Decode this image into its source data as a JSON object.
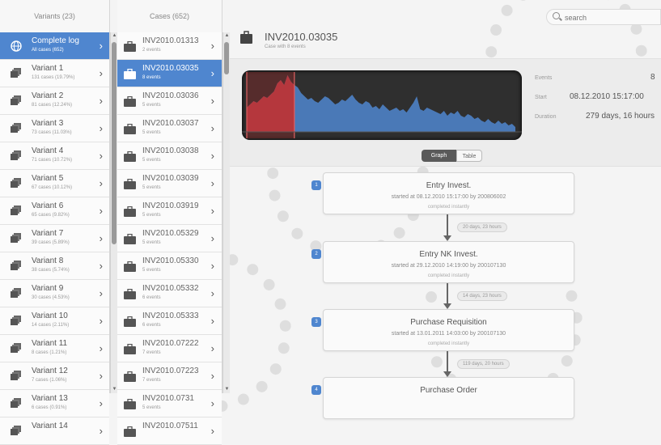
{
  "variants": {
    "header": "Variants (23)",
    "items": [
      {
        "title": "Complete log",
        "sub": "All cases (652)",
        "selected": true
      },
      {
        "title": "Variant 1",
        "sub": "131 cases (19.79%)"
      },
      {
        "title": "Variant 2",
        "sub": "81 cases (12.24%)"
      },
      {
        "title": "Variant 3",
        "sub": "73 cases (11.03%)"
      },
      {
        "title": "Variant 4",
        "sub": "71 cases (10.72%)"
      },
      {
        "title": "Variant 5",
        "sub": "67 cases (10.12%)"
      },
      {
        "title": "Variant 6",
        "sub": "65 cases (9.82%)"
      },
      {
        "title": "Variant 7",
        "sub": "39 cases (5.89%)"
      },
      {
        "title": "Variant 8",
        "sub": "38 cases (5.74%)"
      },
      {
        "title": "Variant 9",
        "sub": "30 cases (4.53%)"
      },
      {
        "title": "Variant 10",
        "sub": "14 cases (2.11%)"
      },
      {
        "title": "Variant 11",
        "sub": "8 cases (1.21%)"
      },
      {
        "title": "Variant 12",
        "sub": "7 cases (1.06%)"
      },
      {
        "title": "Variant 13",
        "sub": "6 cases (0.91%)"
      },
      {
        "title": "Variant 14",
        "sub": ""
      }
    ]
  },
  "cases": {
    "header": "Cases (652)",
    "items": [
      {
        "title": "INV2010.01313",
        "sub": "2 events"
      },
      {
        "title": "INV2010.03035",
        "sub": "8 events",
        "selected": true
      },
      {
        "title": "INV2010.03036",
        "sub": "5 events"
      },
      {
        "title": "INV2010.03037",
        "sub": "5 events"
      },
      {
        "title": "INV2010.03038",
        "sub": "5 events"
      },
      {
        "title": "INV2010.03039",
        "sub": "5 events"
      },
      {
        "title": "INV2010.03919",
        "sub": "5 events"
      },
      {
        "title": "INV2010.05329",
        "sub": "5 events"
      },
      {
        "title": "INV2010.05330",
        "sub": "5 events"
      },
      {
        "title": "INV2010.05332",
        "sub": "6 events"
      },
      {
        "title": "INV2010.05333",
        "sub": "6 events"
      },
      {
        "title": "INV2010.07222",
        "sub": "7 events"
      },
      {
        "title": "INV2010.07223",
        "sub": "7 events"
      },
      {
        "title": "INV2010.0731",
        "sub": "5 events"
      },
      {
        "title": "INV2010.07511",
        "sub": ""
      }
    ]
  },
  "search": {
    "placeholder": "search"
  },
  "case": {
    "title": "INV2010.03035",
    "subtitle": "Case with 8 events",
    "stats": {
      "events_label": "Events",
      "events_value": "8",
      "start_label": "Start",
      "start_value": "08.12.2010 15:17:00",
      "duration_label": "Duration",
      "duration_value": "279 days, 16 hours"
    }
  },
  "view_toggle": {
    "graph": "Graph",
    "table": "Table",
    "active": "Graph"
  },
  "events": [
    {
      "num": "1",
      "name": "Entry Invest.",
      "info": "started at 08.12.2010 15:17:00 by 200806002",
      "status": "completed instantly"
    },
    {
      "num": "2",
      "name": "Entry NK Invest.",
      "info": "started at 29.12.2010 14:19:00 by 200107130",
      "status": "completed instantly"
    },
    {
      "num": "3",
      "name": "Purchase Requisition",
      "info": "started at 13.01.2011 14:03:00 by 200107130",
      "status": "completed instantly"
    },
    {
      "num": "4",
      "name": "Purchase Order",
      "info": "",
      "status": ""
    }
  ],
  "durations": [
    "20 days, 23 hours",
    "14 days, 23 hours",
    "119 days, 20 hours"
  ],
  "colors": {
    "accent": "#4f86cf",
    "chart_bg": "#2f2f2f",
    "chart_area": "#4f86cf",
    "chart_highlight": "#c03030"
  },
  "chart_data": {
    "type": "area",
    "values": [
      30,
      34,
      38,
      36,
      40,
      44,
      42,
      46,
      50,
      60,
      64,
      58,
      70,
      62,
      58,
      55,
      48,
      44,
      40,
      42,
      38,
      36,
      40,
      44,
      42,
      38,
      34,
      36,
      40,
      38,
      42,
      46,
      40,
      36,
      34,
      38,
      36,
      30,
      32,
      28,
      34,
      30,
      26,
      28,
      30,
      26,
      28,
      24,
      30,
      36,
      44,
      28,
      26,
      30,
      28,
      26,
      24,
      22,
      26,
      20,
      24,
      22,
      26,
      20,
      18,
      22,
      20,
      16,
      18,
      14,
      12,
      16,
      12,
      10,
      14,
      10,
      12,
      8,
      10,
      6
    ],
    "highlight_range": [
      0,
      14
    ]
  }
}
